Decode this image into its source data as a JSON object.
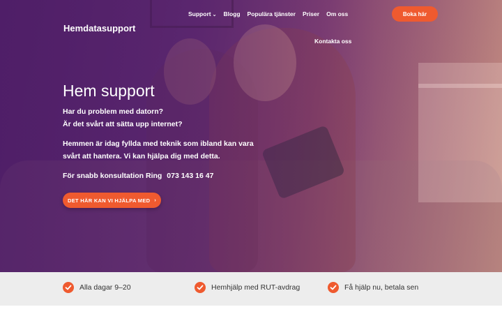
{
  "header": {
    "logo": "Hemdatasupport",
    "nav": {
      "support": "Support",
      "blogg": "Blogg",
      "populara": "Populära tjänster",
      "priser": "Priser",
      "om_oss": "Om oss",
      "kontakta": "Kontakta oss"
    },
    "cta": "Boka här"
  },
  "hero": {
    "title": "Hem support",
    "line1": "Har du problem med datorn?",
    "line2": "Är det svårt att sätta upp internet?",
    "line3": "Hemmen är idag fyllda med teknik som ibland kan vara",
    "line4": "svårt att hantera. Vi kan hjälpa dig med detta.",
    "consult_label": "För snabb konsultation Ring",
    "phone": "073 143 16 47",
    "cta": "DET HÄR KAN VI HJÄLPA MED"
  },
  "features": [
    {
      "label": "Alla dagar 9–20"
    },
    {
      "label": "Hemhjälp med RUT-avdrag"
    },
    {
      "label": "Få hjälp nu, betala sen"
    }
  ],
  "colors": {
    "accent": "#ef5a2f",
    "hero_overlay": "#4b1f63",
    "features_bg": "#ededed"
  },
  "icons": {
    "nav_dropdown": "chevron-down-icon",
    "hero_cta": "arrow-right-icon",
    "feature": "check-circle-icon"
  }
}
